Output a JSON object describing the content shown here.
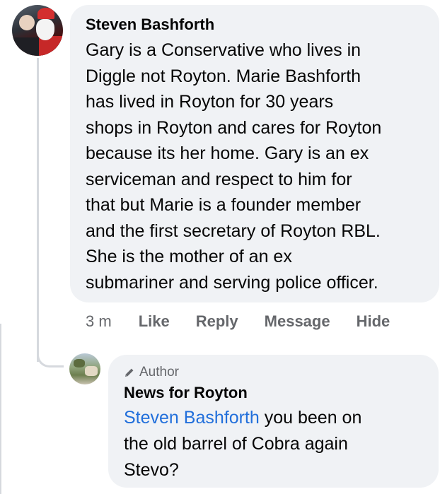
{
  "comment": {
    "author": "Steven Bashforth",
    "lines": [
      "Gary is a Conservative who lives in",
      "Diggle not Royton. Marie Bashforth",
      "has lived in Royton for 30 years",
      "shops in Royton and cares for Royton",
      "because its her home. Gary is an ex",
      "serviceman and respect to him for",
      "that but Marie is a founder member",
      "and the first secretary of Royton RBL.",
      "She is the mother of an ex",
      "submariner and serving police officer."
    ],
    "time": "3 m",
    "actions": {
      "like": "Like",
      "reply": "Reply",
      "message": "Message",
      "hide": "Hide"
    }
  },
  "reply": {
    "badge": "Author",
    "badge_icon": "pencil-icon",
    "author": "News for Royton",
    "mention": "Steven Bashforth",
    "line1_rest": " you been on",
    "line2": "the old barrel of Cobra again",
    "line3": "Stevo?"
  },
  "colors": {
    "bubble": "#f0f2f5",
    "text": "#050505",
    "secondary": "#65676b",
    "mention": "#216fdb"
  }
}
